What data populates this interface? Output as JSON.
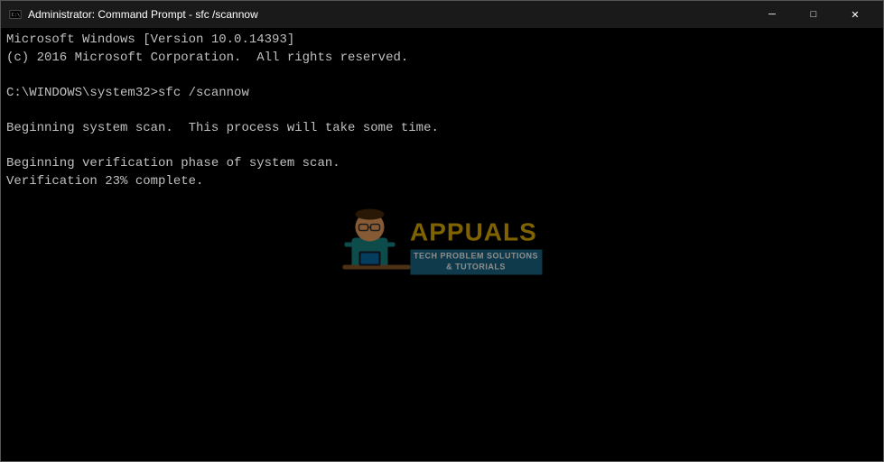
{
  "window": {
    "title": "Administrator: Command Prompt - sfc  /scannow",
    "titlebar_icon": "cmd-icon"
  },
  "controls": {
    "minimize_label": "─",
    "maximize_label": "□",
    "close_label": "✕"
  },
  "terminal": {
    "lines": [
      "Microsoft Windows [Version 10.0.14393]",
      "(c) 2016 Microsoft Corporation.  All rights reserved.",
      "",
      "C:\\WINDOWS\\system32>sfc /scannow",
      "",
      "Beginning system scan.  This process will take some time.",
      "",
      "Beginning verification phase of system scan.",
      "Verification 23% complete.",
      "",
      "",
      "",
      "",
      "",
      "",
      "",
      "",
      "",
      "",
      "",
      "",
      ""
    ]
  },
  "watermark": {
    "brand": "APPUALS",
    "tagline_line1": "TECH PROBLEM SOLUTIONS",
    "tagline_line2": "& TUTORIALS"
  }
}
